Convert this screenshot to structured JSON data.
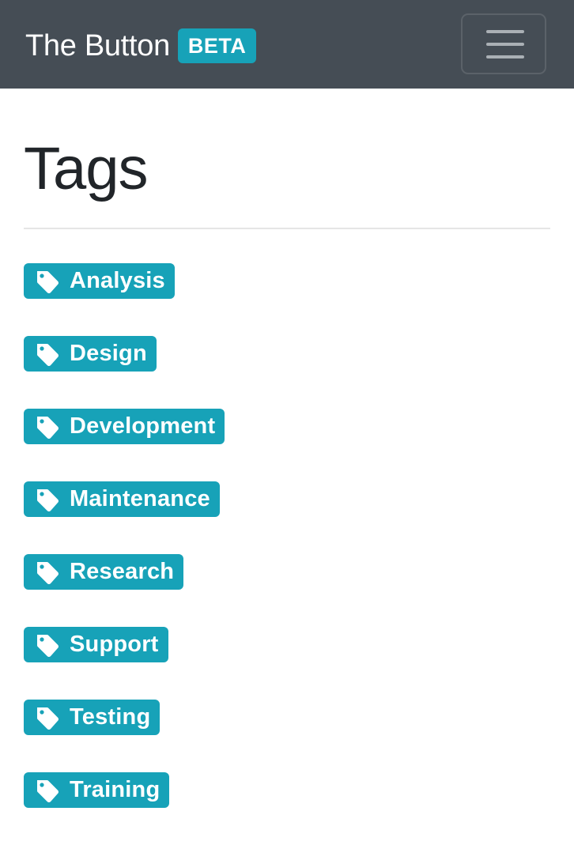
{
  "navbar": {
    "brand": "The Button",
    "badge": "BETA",
    "menu_icon": "hamburger-menu-icon"
  },
  "page": {
    "title": "Tags"
  },
  "colors": {
    "navbar_bg": "#454d55",
    "accent": "#17a2b8",
    "title_text": "#212529"
  },
  "tags": [
    {
      "label": "Analysis",
      "icon": "tag-icon"
    },
    {
      "label": "Design",
      "icon": "tag-icon"
    },
    {
      "label": "Development",
      "icon": "tag-icon"
    },
    {
      "label": "Maintenance",
      "icon": "tag-icon"
    },
    {
      "label": "Research",
      "icon": "tag-icon"
    },
    {
      "label": "Support",
      "icon": "tag-icon"
    },
    {
      "label": "Testing",
      "icon": "tag-icon"
    },
    {
      "label": "Training",
      "icon": "tag-icon"
    }
  ]
}
